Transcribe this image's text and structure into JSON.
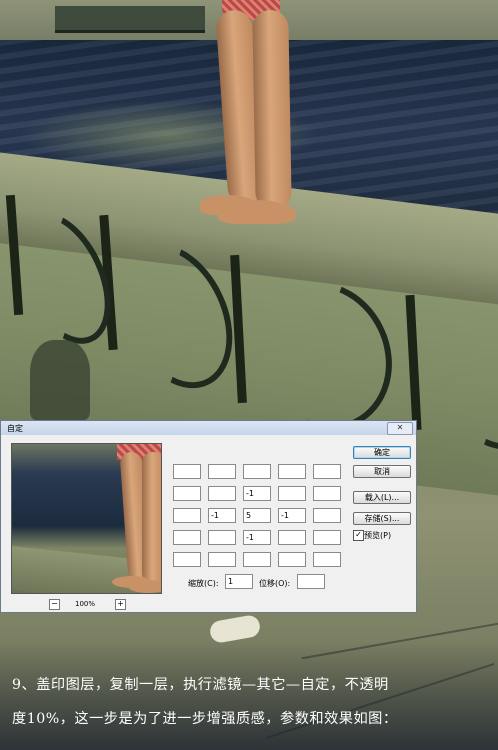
{
  "dialog": {
    "title": "自定",
    "close_icon": "close-icon",
    "close_glyph": "✕",
    "zoom_minus": "−",
    "zoom_plus": "+",
    "zoom_level": "100%",
    "matrix": [
      [
        "",
        "",
        "",
        "",
        ""
      ],
      [
        "",
        "",
        "-1",
        "",
        ""
      ],
      [
        "",
        "-1",
        "5",
        "-1",
        ""
      ],
      [
        "",
        "",
        "-1",
        "",
        ""
      ],
      [
        "",
        "",
        "",
        "",
        ""
      ]
    ],
    "scale_label": "缩放(C):",
    "scale_value": "1",
    "offset_label": "位移(O):",
    "offset_value": "",
    "ok_label": "确定",
    "cancel_label": "取消",
    "load_label": "载入(L)...",
    "save_label": "存储(S)...",
    "preview_label": "预览(P)",
    "preview_checked": true
  },
  "caption": {
    "line1": "9、盖印图层，复制一层，执行滤镜—其它—自定，不透明",
    "line2": "度10%，这一步是为了进一步增强质感，参数和效果如图："
  }
}
